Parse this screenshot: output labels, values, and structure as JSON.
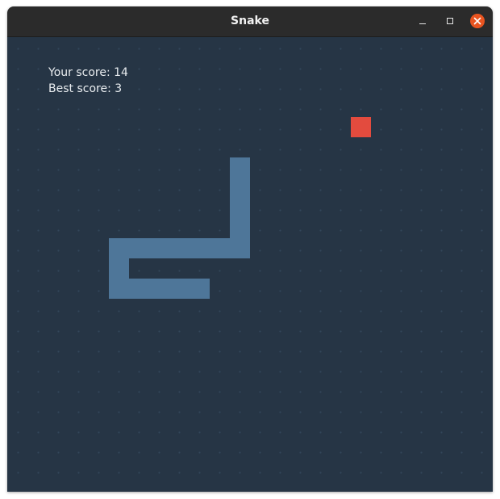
{
  "window": {
    "title": "Snake",
    "controls": [
      "minimize-icon",
      "maximize-icon",
      "close-icon"
    ],
    "close_color": "#e95420"
  },
  "game": {
    "score_label": "Your score: 14",
    "best_label": "Best score: 3",
    "score": 14,
    "best_score": 3,
    "colors": {
      "board": "#263545",
      "snake": "#4e7699",
      "food": "#e34b3e",
      "text": "#e8ecef"
    }
  }
}
